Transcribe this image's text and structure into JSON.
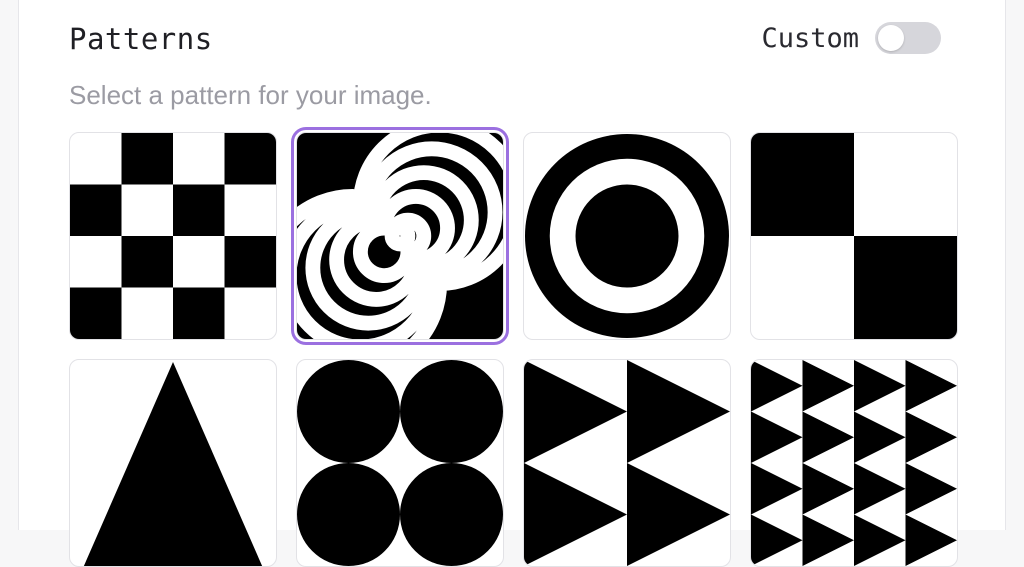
{
  "header": {
    "title": "Patterns",
    "custom_label": "Custom",
    "custom_enabled": false,
    "subtitle": "Select a pattern for your image."
  },
  "colors": {
    "accent": "#9b70e0",
    "toggle_off": "#d6d6db",
    "pattern_fill": "#000000"
  },
  "patterns": [
    {
      "name": "checkerboard",
      "selected": false
    },
    {
      "name": "spiral",
      "selected": true
    },
    {
      "name": "bullseye",
      "selected": false
    },
    {
      "name": "quadrants",
      "selected": false
    },
    {
      "name": "triangle",
      "selected": false
    },
    {
      "name": "circles",
      "selected": false
    },
    {
      "name": "large-triangles",
      "selected": false
    },
    {
      "name": "small-triangles",
      "selected": false
    }
  ]
}
